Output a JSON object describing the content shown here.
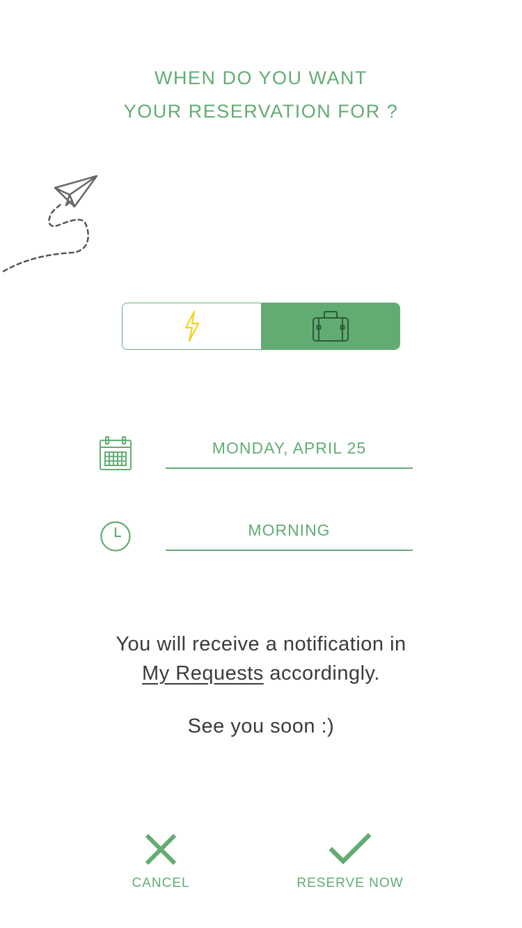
{
  "header": {
    "title_line1": "WHEN DO YOU WANT",
    "title_line2": "YOUR RESERVATION FOR ?"
  },
  "illustration": {
    "icon": "paper-plane-icon"
  },
  "mode_toggle": {
    "options": [
      {
        "icon": "lightning-icon",
        "selected": false
      },
      {
        "icon": "suitcase-icon",
        "selected": true
      }
    ]
  },
  "date_field": {
    "icon": "calendar-icon",
    "value": "MONDAY, APRIL 25"
  },
  "time_field": {
    "icon": "clock-icon",
    "value": "MORNING"
  },
  "message": {
    "line1": "You will receive a notification in",
    "link": "My Requests",
    "line2_suffix": " accordingly.",
    "farewell": "See you soon :)"
  },
  "actions": {
    "cancel_label": "CANCEL",
    "cancel_icon": "close-icon",
    "reserve_label": "RESERVE NOW",
    "reserve_icon": "check-icon"
  },
  "colors": {
    "accent": "#62ac73",
    "text": "#3a3a3a",
    "lightning": "#f2d31b"
  }
}
